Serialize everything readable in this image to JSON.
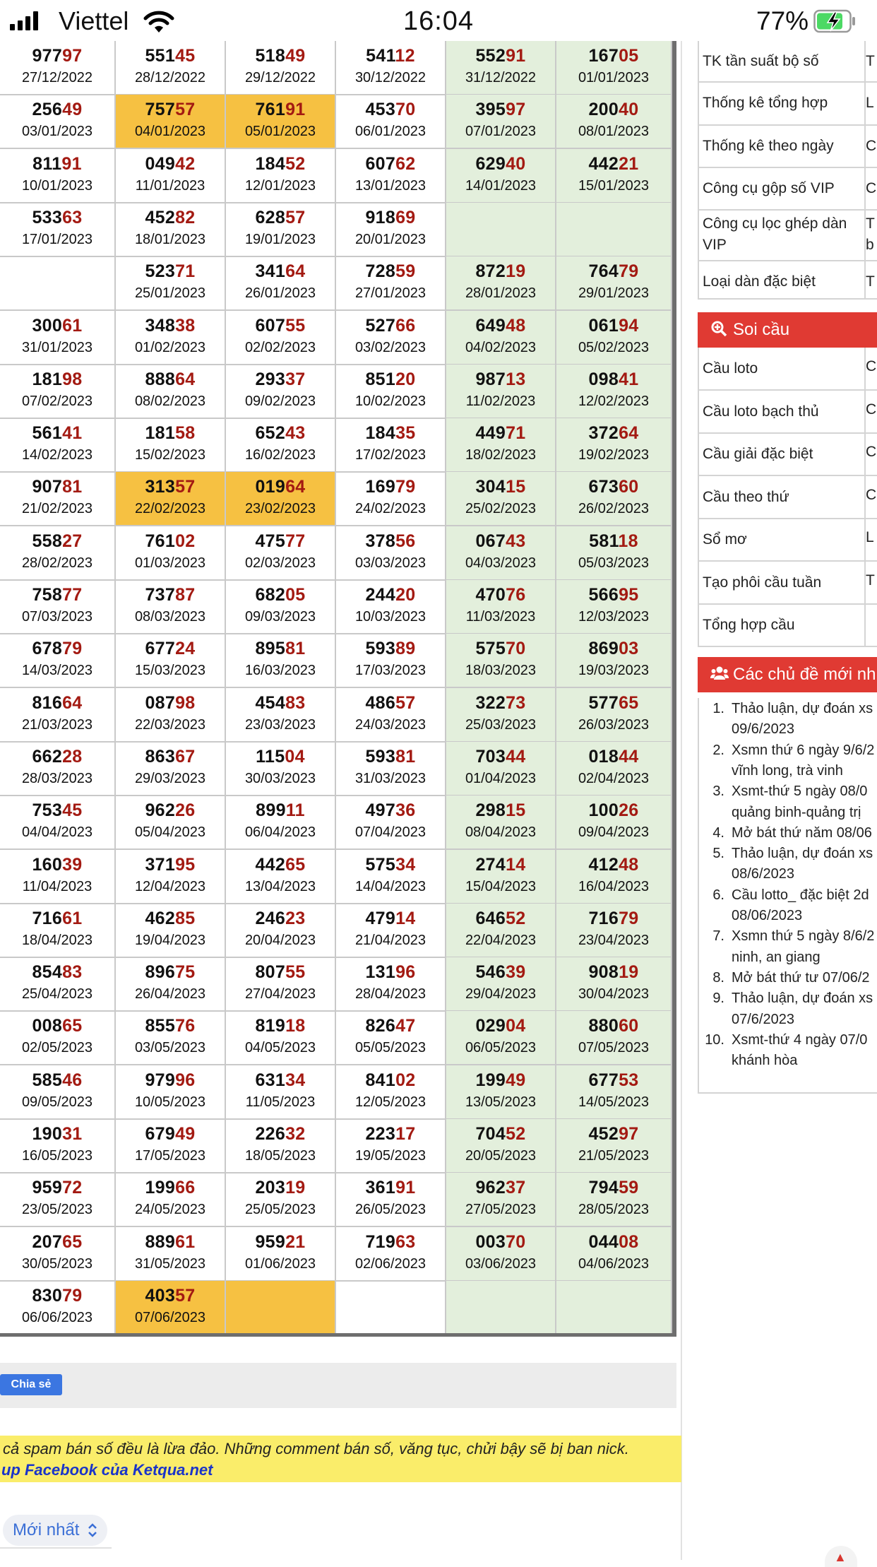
{
  "status_bar": {
    "carrier": "Viettel",
    "time": "16:04",
    "battery": "77%"
  },
  "rows": [
    [
      {
        "n": "97797",
        "d": "27/12/2022"
      },
      {
        "n": "55145",
        "d": "28/12/2022"
      },
      {
        "n": "51849",
        "d": "29/12/2022"
      },
      {
        "n": "54112",
        "d": "30/12/2022"
      },
      {
        "n": "55291",
        "d": "31/12/2022"
      },
      {
        "n": "16705",
        "d": "01/01/2023"
      }
    ],
    [
      {
        "n": "25649",
        "d": "03/01/2023"
      },
      {
        "n": "75757",
        "d": "04/01/2023",
        "hl": true
      },
      {
        "n": "76191",
        "d": "05/01/2023",
        "hl": true
      },
      {
        "n": "45370",
        "d": "06/01/2023"
      },
      {
        "n": "39597",
        "d": "07/01/2023"
      },
      {
        "n": "20040",
        "d": "08/01/2023"
      }
    ],
    [
      {
        "n": "81191",
        "d": "10/01/2023"
      },
      {
        "n": "04942",
        "d": "11/01/2023"
      },
      {
        "n": "18452",
        "d": "12/01/2023"
      },
      {
        "n": "60762",
        "d": "13/01/2023"
      },
      {
        "n": "62940",
        "d": "14/01/2023"
      },
      {
        "n": "44221",
        "d": "15/01/2023"
      }
    ],
    [
      {
        "n": "53363",
        "d": "17/01/2023"
      },
      {
        "n": "45282",
        "d": "18/01/2023"
      },
      {
        "n": "62857",
        "d": "19/01/2023"
      },
      {
        "n": "91869",
        "d": "20/01/2023"
      },
      {
        "n": "",
        "d": ""
      },
      {
        "n": "",
        "d": ""
      }
    ],
    [
      {
        "n": "",
        "d": ""
      },
      {
        "n": "52371",
        "d": "25/01/2023"
      },
      {
        "n": "34164",
        "d": "26/01/2023"
      },
      {
        "n": "72859",
        "d": "27/01/2023"
      },
      {
        "n": "87219",
        "d": "28/01/2023"
      },
      {
        "n": "76479",
        "d": "29/01/2023"
      }
    ],
    [
      {
        "n": "30061",
        "d": "31/01/2023"
      },
      {
        "n": "34838",
        "d": "01/02/2023"
      },
      {
        "n": "60755",
        "d": "02/02/2023"
      },
      {
        "n": "52766",
        "d": "03/02/2023"
      },
      {
        "n": "64948",
        "d": "04/02/2023"
      },
      {
        "n": "06194",
        "d": "05/02/2023"
      }
    ],
    [
      {
        "n": "18198",
        "d": "07/02/2023"
      },
      {
        "n": "88864",
        "d": "08/02/2023"
      },
      {
        "n": "29337",
        "d": "09/02/2023"
      },
      {
        "n": "85120",
        "d": "10/02/2023"
      },
      {
        "n": "98713",
        "d": "11/02/2023"
      },
      {
        "n": "09841",
        "d": "12/02/2023"
      }
    ],
    [
      {
        "n": "56141",
        "d": "14/02/2023"
      },
      {
        "n": "18158",
        "d": "15/02/2023"
      },
      {
        "n": "65243",
        "d": "16/02/2023"
      },
      {
        "n": "18435",
        "d": "17/02/2023"
      },
      {
        "n": "44971",
        "d": "18/02/2023"
      },
      {
        "n": "37264",
        "d": "19/02/2023"
      }
    ],
    [
      {
        "n": "90781",
        "d": "21/02/2023"
      },
      {
        "n": "31357",
        "d": "22/02/2023",
        "hl": true
      },
      {
        "n": "01964",
        "d": "23/02/2023",
        "hl": true
      },
      {
        "n": "16979",
        "d": "24/02/2023"
      },
      {
        "n": "30415",
        "d": "25/02/2023"
      },
      {
        "n": "67360",
        "d": "26/02/2023"
      }
    ],
    [
      {
        "n": "55827",
        "d": "28/02/2023"
      },
      {
        "n": "76102",
        "d": "01/03/2023"
      },
      {
        "n": "47577",
        "d": "02/03/2023"
      },
      {
        "n": "37856",
        "d": "03/03/2023"
      },
      {
        "n": "06743",
        "d": "04/03/2023"
      },
      {
        "n": "58118",
        "d": "05/03/2023"
      }
    ],
    [
      {
        "n": "75877",
        "d": "07/03/2023"
      },
      {
        "n": "73787",
        "d": "08/03/2023"
      },
      {
        "n": "68205",
        "d": "09/03/2023"
      },
      {
        "n": "24420",
        "d": "10/03/2023"
      },
      {
        "n": "47076",
        "d": "11/03/2023"
      },
      {
        "n": "56695",
        "d": "12/03/2023"
      }
    ],
    [
      {
        "n": "67879",
        "d": "14/03/2023"
      },
      {
        "n": "67724",
        "d": "15/03/2023"
      },
      {
        "n": "89581",
        "d": "16/03/2023"
      },
      {
        "n": "59389",
        "d": "17/03/2023"
      },
      {
        "n": "57570",
        "d": "18/03/2023"
      },
      {
        "n": "86903",
        "d": "19/03/2023"
      }
    ],
    [
      {
        "n": "81664",
        "d": "21/03/2023"
      },
      {
        "n": "08798",
        "d": "22/03/2023"
      },
      {
        "n": "45483",
        "d": "23/03/2023"
      },
      {
        "n": "48657",
        "d": "24/03/2023"
      },
      {
        "n": "32273",
        "d": "25/03/2023"
      },
      {
        "n": "57765",
        "d": "26/03/2023"
      }
    ],
    [
      {
        "n": "66228",
        "d": "28/03/2023"
      },
      {
        "n": "86367",
        "d": "29/03/2023"
      },
      {
        "n": "11504",
        "d": "30/03/2023"
      },
      {
        "n": "59381",
        "d": "31/03/2023"
      },
      {
        "n": "70344",
        "d": "01/04/2023"
      },
      {
        "n": "01844",
        "d": "02/04/2023"
      }
    ],
    [
      {
        "n": "75345",
        "d": "04/04/2023"
      },
      {
        "n": "96226",
        "d": "05/04/2023"
      },
      {
        "n": "89911",
        "d": "06/04/2023"
      },
      {
        "n": "49736",
        "d": "07/04/2023"
      },
      {
        "n": "29815",
        "d": "08/04/2023"
      },
      {
        "n": "10026",
        "d": "09/04/2023"
      }
    ],
    [
      {
        "n": "16039",
        "d": "11/04/2023"
      },
      {
        "n": "37195",
        "d": "12/04/2023"
      },
      {
        "n": "44265",
        "d": "13/04/2023"
      },
      {
        "n": "57534",
        "d": "14/04/2023"
      },
      {
        "n": "27414",
        "d": "15/04/2023"
      },
      {
        "n": "41248",
        "d": "16/04/2023"
      }
    ],
    [
      {
        "n": "71661",
        "d": "18/04/2023"
      },
      {
        "n": "46285",
        "d": "19/04/2023"
      },
      {
        "n": "24623",
        "d": "20/04/2023"
      },
      {
        "n": "47914",
        "d": "21/04/2023"
      },
      {
        "n": "64652",
        "d": "22/04/2023"
      },
      {
        "n": "71679",
        "d": "23/04/2023"
      }
    ],
    [
      {
        "n": "85483",
        "d": "25/04/2023"
      },
      {
        "n": "89675",
        "d": "26/04/2023"
      },
      {
        "n": "80755",
        "d": "27/04/2023"
      },
      {
        "n": "13196",
        "d": "28/04/2023"
      },
      {
        "n": "54639",
        "d": "29/04/2023"
      },
      {
        "n": "90819",
        "d": "30/04/2023"
      }
    ],
    [
      {
        "n": "00865",
        "d": "02/05/2023"
      },
      {
        "n": "85576",
        "d": "03/05/2023"
      },
      {
        "n": "81918",
        "d": "04/05/2023"
      },
      {
        "n": "82647",
        "d": "05/05/2023"
      },
      {
        "n": "02904",
        "d": "06/05/2023"
      },
      {
        "n": "88060",
        "d": "07/05/2023"
      }
    ],
    [
      {
        "n": "58546",
        "d": "09/05/2023"
      },
      {
        "n": "97996",
        "d": "10/05/2023"
      },
      {
        "n": "63134",
        "d": "11/05/2023"
      },
      {
        "n": "84102",
        "d": "12/05/2023"
      },
      {
        "n": "19949",
        "d": "13/05/2023"
      },
      {
        "n": "67753",
        "d": "14/05/2023"
      }
    ],
    [
      {
        "n": "19031",
        "d": "16/05/2023"
      },
      {
        "n": "67949",
        "d": "17/05/2023"
      },
      {
        "n": "22632",
        "d": "18/05/2023"
      },
      {
        "n": "22317",
        "d": "19/05/2023"
      },
      {
        "n": "70452",
        "d": "20/05/2023"
      },
      {
        "n": "45297",
        "d": "21/05/2023"
      }
    ],
    [
      {
        "n": "95972",
        "d": "23/05/2023"
      },
      {
        "n": "19966",
        "d": "24/05/2023"
      },
      {
        "n": "20319",
        "d": "25/05/2023"
      },
      {
        "n": "36191",
        "d": "26/05/2023"
      },
      {
        "n": "96237",
        "d": "27/05/2023"
      },
      {
        "n": "79459",
        "d": "28/05/2023"
      }
    ],
    [
      {
        "n": "20765",
        "d": "30/05/2023"
      },
      {
        "n": "88961",
        "d": "31/05/2023"
      },
      {
        "n": "95921",
        "d": "01/06/2023"
      },
      {
        "n": "71963",
        "d": "02/06/2023"
      },
      {
        "n": "00370",
        "d": "03/06/2023"
      },
      {
        "n": "04408",
        "d": "04/06/2023"
      }
    ],
    [
      {
        "n": "83079",
        "d": "06/06/2023"
      },
      {
        "n": "40357",
        "d": "07/06/2023",
        "hl": true
      },
      {
        "n": "",
        "d": "",
        "hl": true
      },
      {
        "n": "",
        "d": ""
      },
      {
        "n": "",
        "d": ""
      },
      {
        "n": "",
        "d": ""
      }
    ]
  ],
  "share_label": "Chia sẻ",
  "notice": {
    "line1": "cả spam bán số đều là lừa đảo. Những comment bán số, văng tục, chửi bậy sẽ bị ban nick.",
    "line2": "up Facebook của Ketqua.net"
  },
  "sort_label": "Mới nhất",
  "sidebar": {
    "tools": [
      {
        "label": "TK tần suất bộ số",
        "cut": "T"
      },
      {
        "label": "Thống kê tổng hợp",
        "cut": "L"
      },
      {
        "label": "Thống kê theo ngày",
        "cut": "C"
      },
      {
        "label": "Công cụ gộp số VIP",
        "cut": "C"
      },
      {
        "label": "Công cụ lọc ghép dàn VIP",
        "cut": "T b"
      },
      {
        "label": "Loại dàn đặc biệt",
        "cut": "T"
      }
    ],
    "soi_cau_title": "Soi cầu",
    "soi_cau": [
      {
        "label": "Cầu loto",
        "cut": "C"
      },
      {
        "label": "Cầu loto bạch thủ",
        "cut": "C"
      },
      {
        "label": "Cầu giải đặc biệt",
        "cut": "C"
      },
      {
        "label": "Cầu theo thứ",
        "cut": "C"
      },
      {
        "label": "Sổ mơ",
        "cut": "L"
      },
      {
        "label": "Tạo phôi cầu tuần",
        "cut": "T"
      },
      {
        "label": "Tổng hợp cầu",
        "cut": ""
      }
    ],
    "topics_title": "Các chủ đề mới nh",
    "topics": [
      {
        "n": "1.",
        "lines": [
          "Thảo luận, dự đoán xs",
          "09/6/2023"
        ]
      },
      {
        "n": "2.",
        "lines": [
          "Xsmn thứ 6 ngày 9/6/2",
          "vĩnh long, trà vinh"
        ]
      },
      {
        "n": "3.",
        "lines": [
          "Xsmt-thứ 5 ngày 08/0",
          "quảng binh-quảng trị"
        ]
      },
      {
        "n": "4.",
        "lines": [
          "Mở bát thứ năm 08/06"
        ]
      },
      {
        "n": "5.",
        "lines": [
          "Thảo luận, dự đoán xs",
          "08/6/2023"
        ]
      },
      {
        "n": "6.",
        "lines": [
          "Cầu lotto_ đặc biệt 2d",
          "08/06/2023"
        ]
      },
      {
        "n": "7.",
        "lines": [
          "Xsmn thứ 5 ngày 8/6/2",
          "ninh, an giang"
        ]
      },
      {
        "n": "8.",
        "lines": [
          "Mở bát thứ tư 07/06/2"
        ]
      },
      {
        "n": "9.",
        "lines": [
          "Thảo luận, dự đoán xs",
          "07/6/2023"
        ]
      },
      {
        "n": "10.",
        "lines": [
          "Xsmt-thứ 4 ngày 07/0",
          "khánh hòa"
        ]
      }
    ]
  },
  "colors": {
    "highlight": "#f6c142",
    "weekend": "#e3efdc",
    "tail": "#a31a12",
    "header": "#e03a33",
    "notice": "#faed6a"
  }
}
